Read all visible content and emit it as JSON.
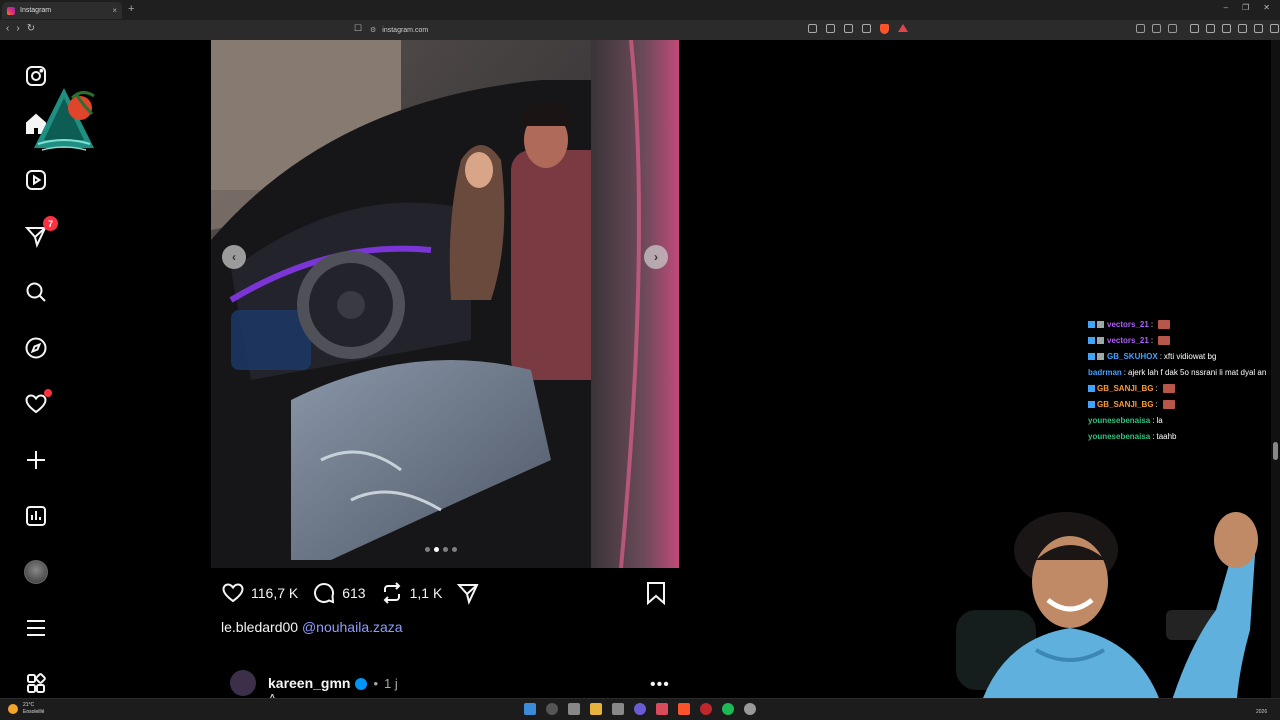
{
  "browser": {
    "tab_title": "Instagram",
    "tab_close": "×",
    "new_tab": "+",
    "url": "instagram.com",
    "window_controls": [
      "–",
      "❐",
      "✕"
    ]
  },
  "sidebar": {
    "notification_count": "7"
  },
  "post": {
    "likes": "116,7 K",
    "comments": "613",
    "reposts": "1,1 K",
    "caption_user": "le.bledard00",
    "caption_tag": "@nouhaila.zaza",
    "carousel_total": 4,
    "carousel_active": 2
  },
  "comment": {
    "user": "kareen_gmn",
    "separator": "•",
    "time": "1 j",
    "text": "A..."
  },
  "chat": [
    {
      "user": "vectors_21",
      "color": "#b05cff",
      "msg": "",
      "emote": true,
      "badges": 2
    },
    {
      "user": "vectors_21",
      "color": "#b05cff",
      "msg": "",
      "emote": true,
      "badges": 2
    },
    {
      "user": "GB_SKUHOX",
      "color": "#3fa3ff",
      "msg": "xfti vidiowat bg",
      "emote": false,
      "badges": 2
    },
    {
      "user": "badrman",
      "color": "#3fa3ff",
      "msg": "ajerk lah f dak 5o nssrani li mat dyal an",
      "emote": false,
      "badges": 0
    },
    {
      "user": "GB_SANJI_BG",
      "color": "#ff9a2e",
      "msg": "",
      "emote": true,
      "badges": 1
    },
    {
      "user": "GB_SANJI_BG",
      "color": "#ff9a2e",
      "msg": "",
      "emote": true,
      "badges": 1
    },
    {
      "user": "younesebenaisa",
      "color": "#2ec27e",
      "msg": "la",
      "emote": false,
      "badges": 0
    },
    {
      "user": "younesebenaisa",
      "color": "#2ec27e",
      "msg": "taahb",
      "emote": false,
      "badges": 0
    }
  ],
  "taskbar": {
    "temp": "21°C",
    "weather": "Ensoleillé",
    "clock": "2026"
  }
}
